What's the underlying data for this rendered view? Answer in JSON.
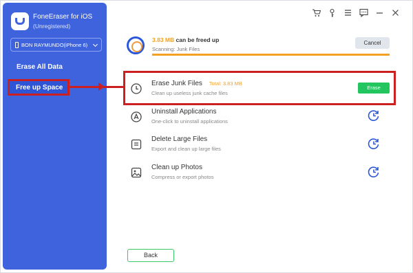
{
  "app": {
    "name": "FoneEraser for iOS",
    "status": "(Unregistered)",
    "device": "BON RAYMUNDO(iPhone 6)"
  },
  "sidebar": {
    "items": [
      {
        "label": "Erase All Data"
      },
      {
        "label": "Free up Space"
      }
    ]
  },
  "scan": {
    "size": "3.83 MB",
    "freed_text": "can be freed up",
    "status": "Scanning: Junk Files",
    "progress": 1.0,
    "cancel_label": "Cancel"
  },
  "items": [
    {
      "title": "Erase Junk Files",
      "total": "Total: 3.83 MB",
      "desc": "Clean up useless junk cache files",
      "action": "Erase"
    },
    {
      "title": "Uninstall Applications",
      "desc": "One-click to uninstall applications"
    },
    {
      "title": "Delete Large Files",
      "desc": "Export and clean up large files"
    },
    {
      "title": "Clean up Photos",
      "desc": "Compress or export photos"
    }
  ],
  "footer": {
    "back_label": "Back"
  },
  "colors": {
    "sidebar": "#3e63dd",
    "accent": "#f4a020",
    "success": "#22c55e",
    "highlight": "#cc1f1f"
  }
}
